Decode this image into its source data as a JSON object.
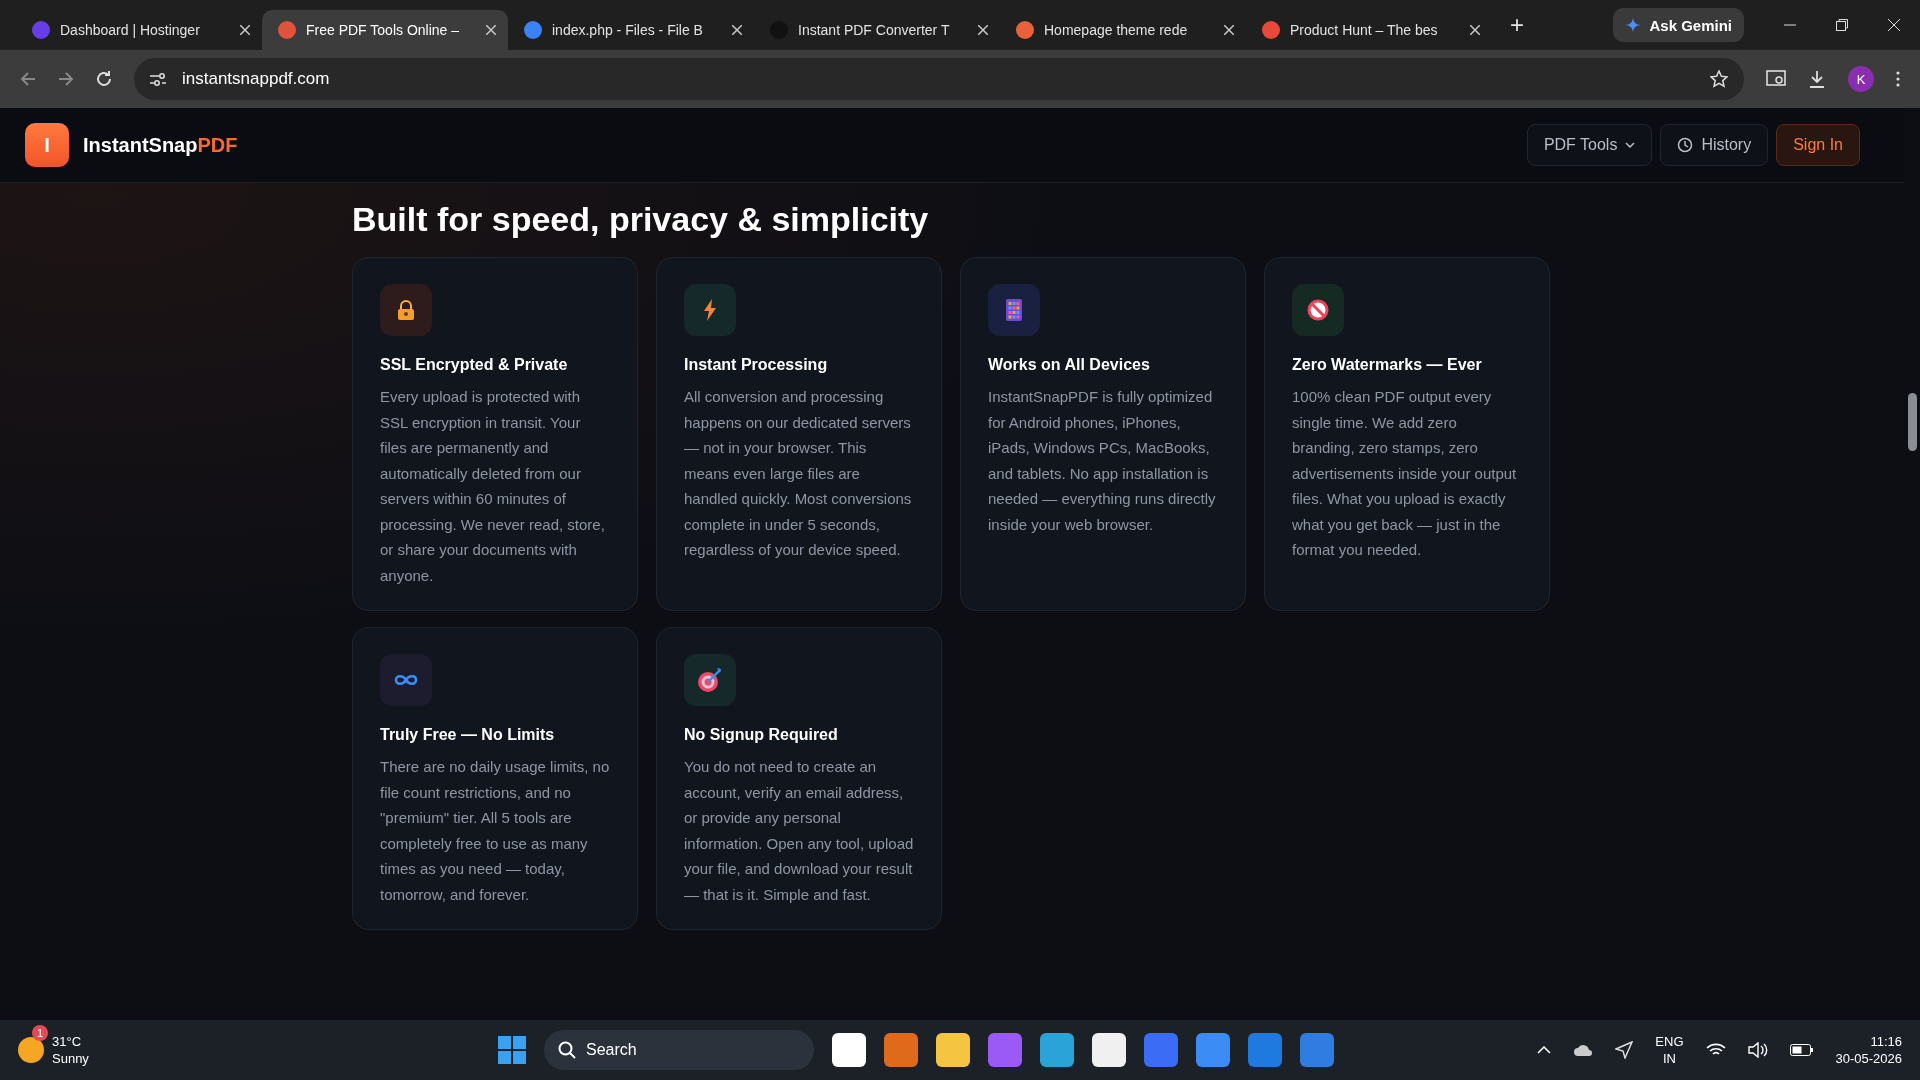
{
  "browser": {
    "tabs": [
      {
        "title": "Dashboard | Hostinger",
        "selected": false
      },
      {
        "title": "Free PDF Tools Online –",
        "selected": true
      },
      {
        "title": "index.php - Files - File B",
        "selected": false
      },
      {
        "title": "Instant PDF Converter T",
        "selected": false
      },
      {
        "title": "Homepage theme rede",
        "selected": false
      },
      {
        "title": "Product Hunt – The bes",
        "selected": false
      }
    ],
    "new_tab": "+",
    "gemini": "Ask Gemini",
    "url": "instantsnappdf.com",
    "profile": "K"
  },
  "site": {
    "logo_letter": "I",
    "brand": "InstantSnap",
    "brand_accent": "PDF",
    "nav": {
      "tools": "PDF Tools",
      "history": "History",
      "signin": "Sign In"
    },
    "heading": "Built for speed, privacy & simplicity",
    "features": [
      {
        "title": "SSL Encrypted & Private",
        "text": "Every upload is protected with SSL encryption in transit. Your files are permanently and automatically deleted from our servers within 60 minutes of processing. We never read, store, or share your documents with anyone."
      },
      {
        "title": "Instant Processing",
        "text": "All conversion and processing happens on our dedicated servers — not in your browser. This means even large files are handled quickly. Most conversions complete in under 5 seconds, regardless of your device speed."
      },
      {
        "title": "Works on All Devices",
        "text": "InstantSnapPDF is fully optimized for Android phones, iPhones, iPads, Windows PCs, MacBooks, and tablets. No app installation is needed — everything runs directly inside your web browser."
      },
      {
        "title": "Zero Watermarks — Ever",
        "text": "100% clean PDF output every single time. We add zero branding, zero stamps, zero advertisements inside your output files. What you upload is exactly what you get back — just in the format you needed."
      },
      {
        "title": "Truly Free — No Limits",
        "text": "There are no daily usage limits, no file count restrictions, and no \"premium\" tier. All 5 tools are completely free to use as many times as you need — today, tomorrow, and forever."
      },
      {
        "title": "No Signup Required",
        "text": "You do not need to create an account, verify an email address, or provide any personal information. Open any tool, upload your file, and download your result — that is it. Simple and fast."
      }
    ]
  },
  "taskbar": {
    "weather_badge": "1",
    "temperature": "31°C",
    "condition": "Sunny",
    "search": "Search",
    "lang": "ENG",
    "region": "IN",
    "time": "11:16",
    "date": "30-05-2026"
  }
}
